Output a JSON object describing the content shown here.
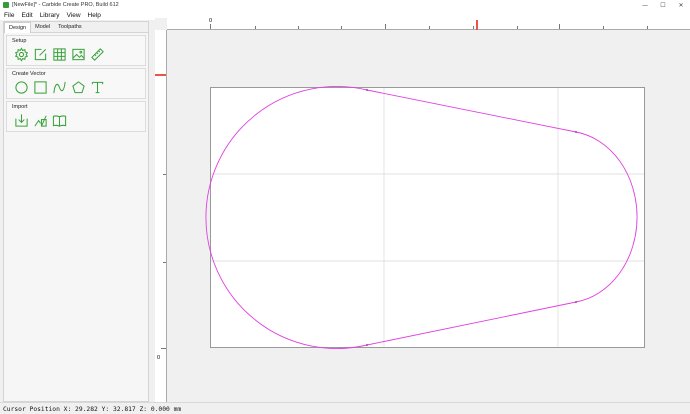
{
  "window": {
    "title": "[NewFile]* - Carbide Create PRO, Build 612",
    "controls": [
      "—",
      "☐",
      "✕"
    ]
  },
  "menubar": {
    "items": [
      "File",
      "Edit",
      "Library",
      "View",
      "Help"
    ]
  },
  "left_panel": {
    "tabs": [
      "Design",
      "Model",
      "Toolpaths"
    ],
    "active_tab": "Design",
    "sections": {
      "setup": {
        "title": "Setup",
        "icons": [
          "gear-icon",
          "edit-icon",
          "grid-icon",
          "image-icon",
          "ruler-icon"
        ]
      },
      "create_vector": {
        "title": "Create Vector",
        "icons": [
          "circle-icon",
          "rectangle-icon",
          "curve-icon",
          "polygon-icon",
          "text-icon"
        ]
      },
      "import": {
        "title": "Import",
        "icons": [
          "import-icon",
          "import-image-icon",
          "library-icon"
        ]
      }
    }
  },
  "canvas": {
    "ruler_top_label": "0",
    "ruler_left_label": "0",
    "accent_color": "#e040e0",
    "ruler_mark_color": "#e8554a"
  },
  "status": {
    "cursor_position": "Cursor Position X: 29.282 Y: 32.817 Z: 0.000 mm"
  }
}
